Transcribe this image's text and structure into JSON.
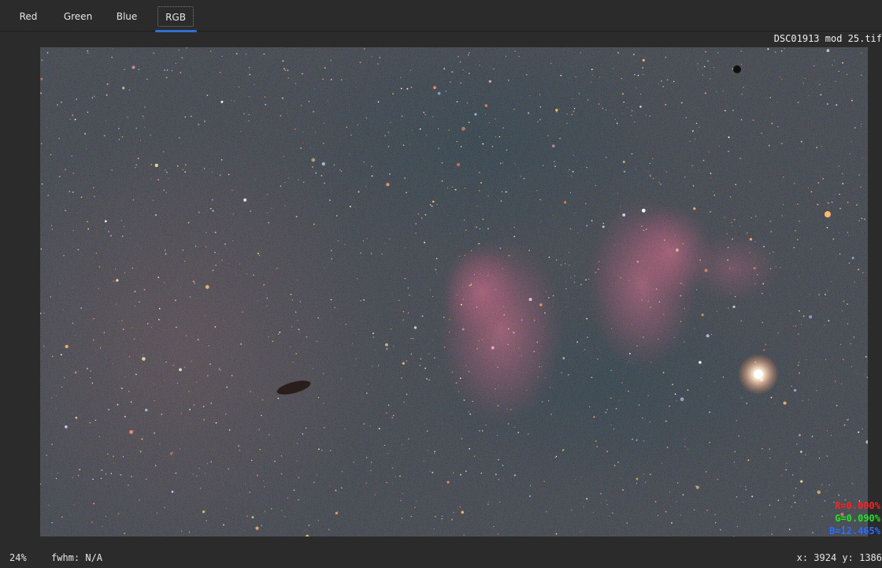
{
  "tabs": [
    {
      "label": "Red",
      "active": false
    },
    {
      "label": "Green",
      "active": false
    },
    {
      "label": "Blue",
      "active": false
    },
    {
      "label": "RGB",
      "active": true
    }
  ],
  "filename": "DSC01913 mod 25.tif",
  "image": {
    "alt": "Astronomical RGB image of a star field with reddish nebulae",
    "colors": {
      "background": "#253334",
      "nebula": "#c45a72",
      "accent": "#2f6fd6"
    }
  },
  "readouts": {
    "r": {
      "text": "R=0.000%",
      "color": "#ff2020"
    },
    "g": {
      "text": "G=0.090%",
      "color": "#22e02a"
    },
    "b": {
      "text": "B=12.465%",
      "color": "#2a6cff"
    }
  },
  "status": {
    "zoom": "24%",
    "fwhm": "fwhm: N/A",
    "coords": "x: 3924 y: 1386"
  }
}
